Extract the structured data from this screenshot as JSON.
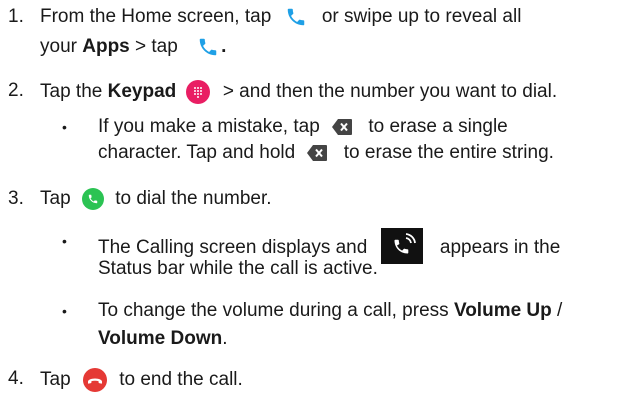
{
  "steps": [
    {
      "number": "1.",
      "line1": {
        "a": "From the Home screen, tap",
        "b": "or swipe up to reveal all"
      },
      "line2": {
        "a": "your",
        "apps": "Apps",
        "b": "> tap",
        "c": "."
      }
    },
    {
      "number": "2.",
      "line1": {
        "a": "Tap the",
        "keypad": "Keypad",
        "b": "> and then the number you want to dial."
      },
      "bullet": {
        "line1": {
          "a": "If you make a mistake, tap",
          "b": "to erase a single"
        },
        "line2": {
          "a": "character. Tap and hold",
          "b": "to erase the entire string."
        }
      }
    },
    {
      "number": "3.",
      "line1": {
        "a": "Tap",
        "b": "to dial the number."
      },
      "bullet1": {
        "line1": {
          "a": "The Calling screen displays and",
          "b": "appears in the"
        },
        "line2": "Status bar while the call is active."
      },
      "bullet2": {
        "line1": {
          "a": "To change the volume during a call, press",
          "vol_up": "Volume Up",
          "slash": "/"
        },
        "line2": {
          "vol_down": "Volume Down",
          "period": "."
        }
      }
    },
    {
      "number": "4.",
      "line1": {
        "a": "Tap",
        "b": "to end the call."
      }
    }
  ],
  "bullet_glyph": "•",
  "icons": {
    "phone": "phone-handset-icon",
    "keypad": "keypad-dots-icon",
    "backspace": "backspace-icon",
    "dial": "dial-call-icon",
    "call_status": "call-status-icon",
    "end_call": "end-call-icon"
  },
  "colors": {
    "phone_blue": "#1fa0e6",
    "keypad_pink": "#e91e63",
    "dial_green": "#2bc353",
    "end_red": "#e53935",
    "backspace_gray": "#444444",
    "status_black": "#111111"
  }
}
